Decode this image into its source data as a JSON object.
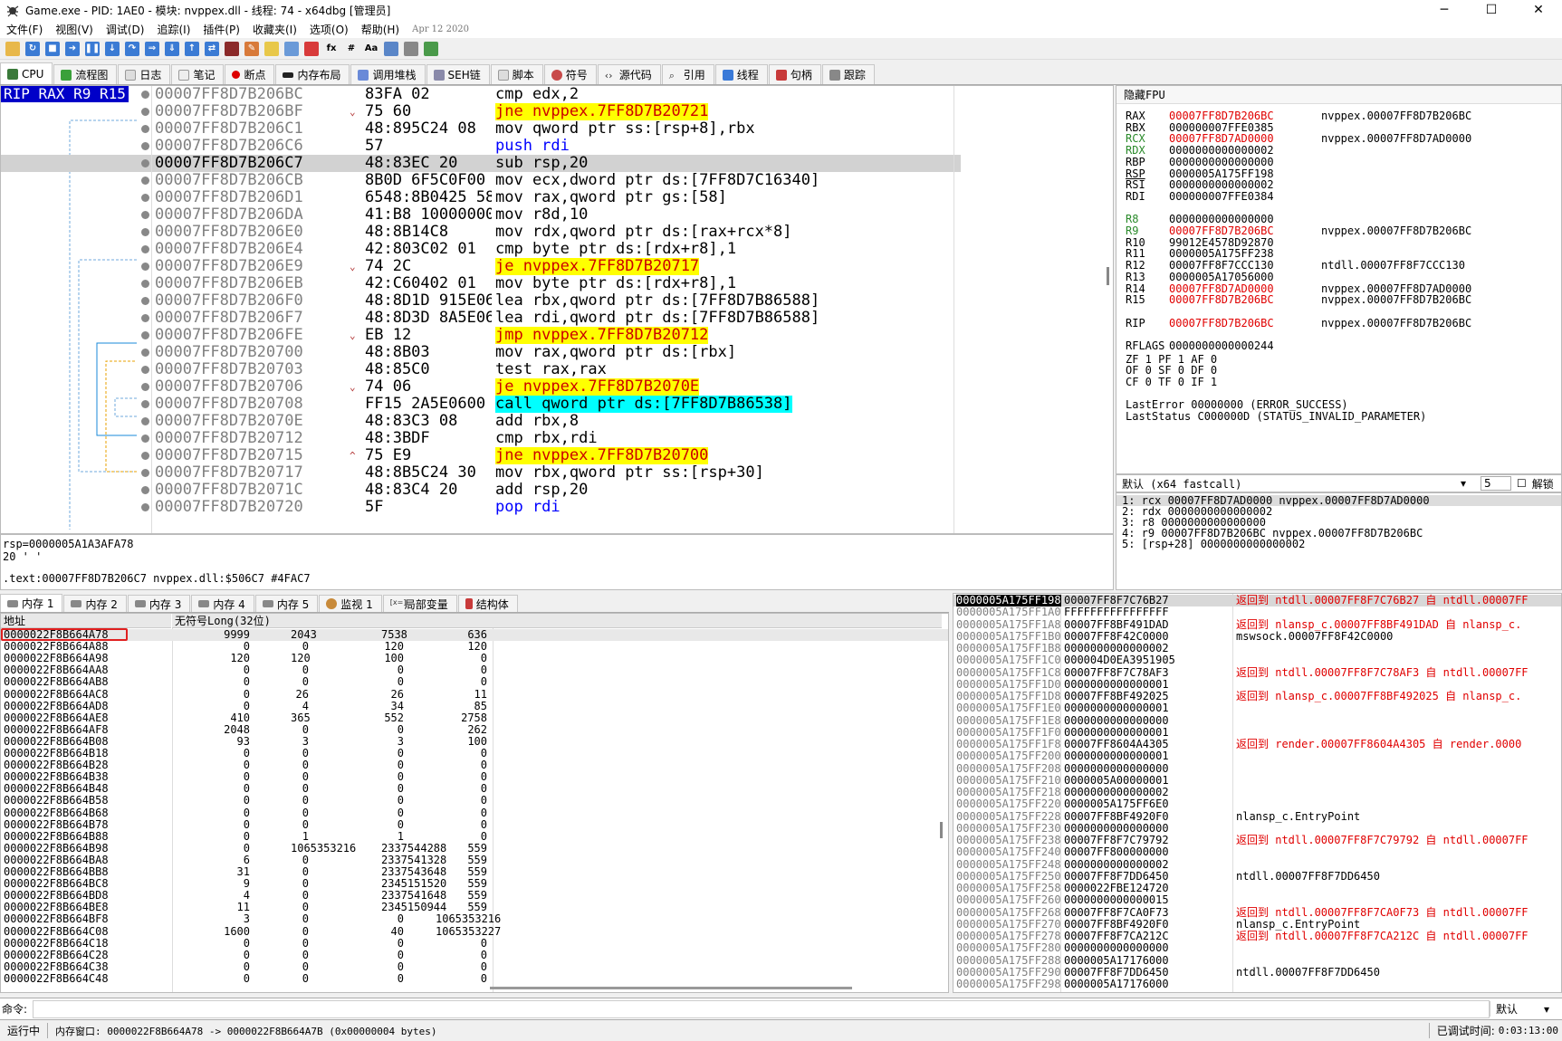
{
  "window": {
    "title": "Game.exe - PID: 1AE0 - 模块: nvppex.dll - 线程: 74 - x64dbg [管理员]"
  },
  "menu": {
    "items": [
      "文件(F)",
      "视图(V)",
      "调试(D)",
      "追踪(I)",
      "插件(P)",
      "收藏夹(I)",
      "选项(O)",
      "帮助(H)"
    ],
    "date": "Apr 12 2020"
  },
  "tabs": [
    "CPU",
    "流程图",
    "日志",
    "笔记",
    "断点",
    "内存布局",
    "调用堆栈",
    "SEH链",
    "脚本",
    "符号",
    "源代码",
    "引用",
    "线程",
    "句柄",
    "跟踪"
  ],
  "disasm": {
    "reg_label": "RIP RAX R9 R15",
    "rows": [
      {
        "addr": "00007FF8D7B206BC",
        "arrow": "",
        "bytes": "83FA 02",
        "inst": "cmp edx,2"
      },
      {
        "addr": "00007FF8D7B206BF",
        "arrow": "⌄",
        "bytes": "75 60",
        "inst": "jne nvppex.7FF8D7B20721"
      },
      {
        "addr": "00007FF8D7B206C1",
        "arrow": "",
        "bytes": "48:895C24 08",
        "inst": "mov qword ptr ss:[rsp+8],rbx"
      },
      {
        "addr": "00007FF8D7B206C6",
        "arrow": "",
        "bytes": "57",
        "inst": "push rdi"
      },
      {
        "addr": "00007FF8D7B206C7",
        "arrow": "",
        "bytes": "48:83EC 20",
        "inst": "sub rsp,20"
      },
      {
        "addr": "00007FF8D7B206CB",
        "arrow": "",
        "bytes": "8B0D 6F5C0F00",
        "inst": "mov ecx,dword ptr ds:[7FF8D7C16340]"
      },
      {
        "addr": "00007FF8D7B206D1",
        "arrow": "",
        "bytes": "6548:8B0425 58",
        "inst": "mov rax,qword ptr gs:[58]"
      },
      {
        "addr": "00007FF8D7B206DA",
        "arrow": "",
        "bytes": "41:B8 10000000",
        "inst": "mov r8d,10"
      },
      {
        "addr": "00007FF8D7B206E0",
        "arrow": "",
        "bytes": "48:8B14C8",
        "inst": "mov rdx,qword ptr ds:[rax+rcx*8]"
      },
      {
        "addr": "00007FF8D7B206E4",
        "arrow": "",
        "bytes": "42:803C02 01",
        "inst": "cmp byte ptr ds:[rdx+r8],1"
      },
      {
        "addr": "00007FF8D7B206E9",
        "arrow": "⌄",
        "bytes": "74 2C",
        "inst": "je nvppex.7FF8D7B20717"
      },
      {
        "addr": "00007FF8D7B206EB",
        "arrow": "",
        "bytes": "42:C60402 01",
        "inst": "mov byte ptr ds:[rdx+r8],1"
      },
      {
        "addr": "00007FF8D7B206F0",
        "arrow": "",
        "bytes": "48:8D1D 915E06",
        "inst": "lea rbx,qword ptr ds:[7FF8D7B86588]"
      },
      {
        "addr": "00007FF8D7B206F7",
        "arrow": "",
        "bytes": "48:8D3D 8A5E06",
        "inst": "lea rdi,qword ptr ds:[7FF8D7B86588]"
      },
      {
        "addr": "00007FF8D7B206FE",
        "arrow": "⌄",
        "bytes": "EB 12",
        "inst": "jmp nvppex.7FF8D7B20712"
      },
      {
        "addr": "00007FF8D7B20700",
        "arrow": "",
        "bytes": "48:8B03",
        "inst": "mov rax,qword ptr ds:[rbx]"
      },
      {
        "addr": "00007FF8D7B20703",
        "arrow": "",
        "bytes": "48:85C0",
        "inst": "test rax,rax"
      },
      {
        "addr": "00007FF8D7B20706",
        "arrow": "⌄",
        "bytes": "74 06",
        "inst": "je nvppex.7FF8D7B2070E"
      },
      {
        "addr": "00007FF8D7B20708",
        "arrow": "",
        "bytes": "FF15 2A5E0600",
        "inst": "call qword ptr ds:[7FF8D7B86538]"
      },
      {
        "addr": "00007FF8D7B2070E",
        "arrow": "",
        "bytes": "48:83C3 08",
        "inst": "add rbx,8"
      },
      {
        "addr": "00007FF8D7B20712",
        "arrow": "",
        "bytes": "48:3BDF",
        "inst": "cmp rbx,rdi"
      },
      {
        "addr": "00007FF8D7B20715",
        "arrow": "^",
        "bytes": "75 E9",
        "inst": "jne nvppex.7FF8D7B20700"
      },
      {
        "addr": "00007FF8D7B20717",
        "arrow": "",
        "bytes": "48:8B5C24 30",
        "inst": "mov rbx,qword ptr ss:[rsp+30]"
      },
      {
        "addr": "00007FF8D7B2071C",
        "arrow": "",
        "bytes": "48:83C4 20",
        "inst": "add rsp,20"
      },
      {
        "addr": "00007FF8D7B20720",
        "arrow": "",
        "bytes": "5F",
        "inst": "pop rdi"
      }
    ]
  },
  "info": {
    "line1": "rsp=0000005A1A3AFA78",
    "line2": "20 ' '",
    "line3": ".text:00007FF8D7B206C7 nvppex.dll:$506C7 #4FAC7"
  },
  "registers": {
    "header": "隐藏FPU",
    "rows": [
      {
        "name": "RAX",
        "value": "00007FF8D7B206BC",
        "comment": "nvppex.00007FF8D7B206BC",
        "red": true
      },
      {
        "name": "RBX",
        "value": "000000007FFE0385",
        "comment": "",
        "red": false
      },
      {
        "name": "RCX",
        "value": "00007FF8D7AD0000",
        "comment": "nvppex.00007FF8D7AD0000",
        "red": true
      },
      {
        "name": "RDX",
        "value": "0000000000000002",
        "comment": "",
        "red": false
      },
      {
        "name": "RBP",
        "value": "0000000000000000",
        "comment": "",
        "red": false
      },
      {
        "name": "RSP",
        "value": "0000005A175FF198",
        "comment": "",
        "red": false
      },
      {
        "name": "RSI",
        "value": "0000000000000002",
        "comment": "",
        "red": false
      },
      {
        "name": "RDI",
        "value": "000000007FFE0384",
        "comment": "",
        "red": false
      },
      {
        "name": "",
        "value": "",
        "comment": "",
        "red": false
      },
      {
        "name": "R8",
        "value": "0000000000000000",
        "comment": "",
        "red": false
      },
      {
        "name": "R9",
        "value": "00007FF8D7B206BC",
        "comment": "nvppex.00007FF8D7B206BC",
        "red": true
      },
      {
        "name": "R10",
        "value": "99012E4578D92870",
        "comment": "",
        "red": false
      },
      {
        "name": "R11",
        "value": "0000005A175FF238",
        "comment": "",
        "red": false
      },
      {
        "name": "R12",
        "value": "00007FF8F7CCC130",
        "comment": "ntdll.00007FF8F7CCC130",
        "red": false
      },
      {
        "name": "R13",
        "value": "0000005A17056000",
        "comment": "",
        "red": false
      },
      {
        "name": "R14",
        "value": "00007FF8D7AD0000",
        "comment": "nvppex.00007FF8D7AD0000",
        "red": true
      },
      {
        "name": "R15",
        "value": "00007FF8D7B206BC",
        "comment": "nvppex.00007FF8D7B206BC",
        "red": true
      },
      {
        "name": "",
        "value": "",
        "comment": "",
        "red": false
      },
      {
        "name": "RIP",
        "value": "00007FF8D7B206BC",
        "comment": "nvppex.00007FF8D7B206BC",
        "red": true
      },
      {
        "name": "",
        "value": "",
        "comment": "",
        "red": false
      },
      {
        "name": "RFLAGS",
        "value": "0000000000000244",
        "comment": "",
        "red": false
      }
    ],
    "flags": [
      "ZF 1   PF 1   AF 0",
      "OF 0   SF 0   DF 0",
      "CF 0   TF 0   IF 1"
    ],
    "lasterror": "LastError  00000000 (ERROR_SUCCESS)",
    "laststatus": "LastStatus C000000D (STATUS_INVALID_PARAMETER)"
  },
  "callconv": {
    "label": "默认 (x64 fastcall)",
    "count": "5",
    "unlock": "解锁"
  },
  "args": [
    "1: rcx 00007FF8D7AD0000 nvppex.00007FF8D7AD0000",
    "2: rdx 0000000000000002",
    "3: r8 0000000000000000",
    "4: r9 00007FF8D7B206BC nvppex.00007FF8D7B206BC",
    "5: [rsp+28] 0000000000000002"
  ],
  "memtabs": [
    "内存 1",
    "内存 2",
    "内存 3",
    "内存 4",
    "内存 5",
    "监视 1",
    "局部变量",
    "结构体"
  ],
  "dump": {
    "col_addr": "地址",
    "col_type": "无符号Long(32位)",
    "rows": [
      [
        "0000022F8B664A78",
        "9999",
        "2043",
        "7538",
        "636"
      ],
      [
        "0000022F8B664A88",
        "0",
        "0",
        "120",
        "120"
      ],
      [
        "0000022F8B664A98",
        "120",
        "120",
        "100",
        "0"
      ],
      [
        "0000022F8B664AA8",
        "0",
        "0",
        "0",
        "0"
      ],
      [
        "0000022F8B664AB8",
        "0",
        "0",
        "0",
        "0"
      ],
      [
        "0000022F8B664AC8",
        "0",
        "26",
        "26",
        "11"
      ],
      [
        "0000022F8B664AD8",
        "0",
        "4",
        "34",
        "85"
      ],
      [
        "0000022F8B664AE8",
        "410",
        "365",
        "552",
        "2758"
      ],
      [
        "0000022F8B664AF8",
        "2048",
        "0",
        "0",
        "262"
      ],
      [
        "0000022F8B664B08",
        "93",
        "3",
        "3",
        "100"
      ],
      [
        "0000022F8B664B18",
        "0",
        "0",
        "0",
        "0"
      ],
      [
        "0000022F8B664B28",
        "0",
        "0",
        "0",
        "0"
      ],
      [
        "0000022F8B664B38",
        "0",
        "0",
        "0",
        "0"
      ],
      [
        "0000022F8B664B48",
        "0",
        "0",
        "0",
        "0"
      ],
      [
        "0000022F8B664B58",
        "0",
        "0",
        "0",
        "0"
      ],
      [
        "0000022F8B664B68",
        "0",
        "0",
        "0",
        "0"
      ],
      [
        "0000022F8B664B78",
        "0",
        "0",
        "0",
        "0"
      ],
      [
        "0000022F8B664B88",
        "0",
        "1",
        "1",
        "0"
      ],
      [
        "0000022F8B664B98",
        "0",
        "1065353216",
        "2337544288",
        "559"
      ],
      [
        "0000022F8B664BA8",
        "6",
        "0",
        "2337541328",
        "559"
      ],
      [
        "0000022F8B664BB8",
        "31",
        "0",
        "2337543648",
        "559"
      ],
      [
        "0000022F8B664BC8",
        "9",
        "0",
        "2345151520",
        "559"
      ],
      [
        "0000022F8B664BD8",
        "4",
        "0",
        "2337541648",
        "559"
      ],
      [
        "0000022F8B664BE8",
        "11",
        "0",
        "2345150944",
        "559"
      ],
      [
        "0000022F8B664BF8",
        "3",
        "0",
        "0",
        "1065353216"
      ],
      [
        "0000022F8B664C08",
        "1600",
        "0",
        "40",
        "1065353227"
      ],
      [
        "0000022F8B664C18",
        "0",
        "0",
        "0",
        "0"
      ],
      [
        "0000022F8B664C28",
        "0",
        "0",
        "0",
        "0"
      ],
      [
        "0000022F8B664C38",
        "0",
        "0",
        "0",
        "0"
      ],
      [
        "0000022F8B664C48",
        "0",
        "0",
        "0",
        "0"
      ]
    ]
  },
  "stack": {
    "rows": [
      {
        "addr": "0000005A175FF198",
        "val": "00007FF8F7C76B27",
        "comment": "返回到 ntdll.00007FF8F7C76B27 自 ntdll.00007FF",
        "red": true
      },
      {
        "addr": "0000005A175FF1A0",
        "val": "FFFFFFFFFFFFFFFF",
        "comment": "",
        "red": false
      },
      {
        "addr": "0000005A175FF1A8",
        "val": "00007FF8BF491DAD",
        "comment": "返回到 nlansp_c.00007FF8BF491DAD 自 nlansp_c.",
        "red": true
      },
      {
        "addr": "0000005A175FF1B0",
        "val": "00007FF8F42C0000",
        "comment": "mswsock.00007FF8F42C0000",
        "red": false
      },
      {
        "addr": "0000005A175FF1B8",
        "val": "0000000000000002",
        "comment": "",
        "red": false
      },
      {
        "addr": "0000005A175FF1C0",
        "val": "000004D0EA3951905",
        "comment": "",
        "red": false
      },
      {
        "addr": "0000005A175FF1C8",
        "val": "00007FF8F7C78AF3",
        "comment": "返回到 ntdll.00007FF8F7C78AF3 自 ntdll.00007FF",
        "red": true
      },
      {
        "addr": "0000005A175FF1D0",
        "val": "0000000000000001",
        "comment": "",
        "red": false
      },
      {
        "addr": "0000005A175FF1D8",
        "val": "00007FF8BF492025",
        "comment": "返回到 nlansp_c.00007FF8BF492025 自 nlansp_c.",
        "red": true
      },
      {
        "addr": "0000005A175FF1E0",
        "val": "0000000000000001",
        "comment": "",
        "red": false
      },
      {
        "addr": "0000005A175FF1E8",
        "val": "0000000000000000",
        "comment": "",
        "red": false
      },
      {
        "addr": "0000005A175FF1F0",
        "val": "0000000000000001",
        "comment": "",
        "red": false
      },
      {
        "addr": "0000005A175FF1F8",
        "val": "00007FF8604A4305",
        "comment": "返回到 render.00007FF8604A4305 自 render.0000",
        "red": true
      },
      {
        "addr": "0000005A175FF200",
        "val": "0000000000000001",
        "comment": "",
        "red": false
      },
      {
        "addr": "0000005A175FF208",
        "val": "0000000000000000",
        "comment": "",
        "red": false
      },
      {
        "addr": "0000005A175FF210",
        "val": "0000005A00000001",
        "comment": "",
        "red": false
      },
      {
        "addr": "0000005A175FF218",
        "val": "0000000000000002",
        "comment": "",
        "red": false
      },
      {
        "addr": "0000005A175FF220",
        "val": "0000005A175FF6E0",
        "comment": "",
        "red": false
      },
      {
        "addr": "0000005A175FF228",
        "val": "00007FF8BF4920F0",
        "comment": "nlansp_c.EntryPoint",
        "red": false
      },
      {
        "addr": "0000005A175FF230",
        "val": "0000000000000000",
        "comment": "",
        "red": false
      },
      {
        "addr": "0000005A175FF238",
        "val": "00007FF8F7C79792",
        "comment": "返回到 ntdll.00007FF8F7C79792 自 ntdll.00007FF",
        "red": true
      },
      {
        "addr": "0000005A175FF240",
        "val": "00007FF800000000",
        "comment": "",
        "red": false
      },
      {
        "addr": "0000005A175FF248",
        "val": "0000000000000002",
        "comment": "",
        "red": false
      },
      {
        "addr": "0000005A175FF250",
        "val": "00007FF8F7DD6450",
        "comment": "ntdll.00007FF8F7DD6450",
        "red": false
      },
      {
        "addr": "0000005A175FF258",
        "val": "0000022FBE124720",
        "comment": "",
        "red": false
      },
      {
        "addr": "0000005A175FF260",
        "val": "0000000000000015",
        "comment": "",
        "red": false
      },
      {
        "addr": "0000005A175FF268",
        "val": "00007FF8F7CA0F73",
        "comment": "返回到 ntdll.00007FF8F7CA0F73 自 ntdll.00007FF",
        "red": true
      },
      {
        "addr": "0000005A175FF270",
        "val": "00007FF8BF4920F0",
        "comment": "nlansp_c.EntryPoint",
        "red": false
      },
      {
        "addr": "0000005A175FF278",
        "val": "00007FF8F7CA212C",
        "comment": "返回到 ntdll.00007FF8F7CA212C 自 ntdll.00007FF",
        "red": true
      },
      {
        "addr": "0000005A175FF280",
        "val": "0000000000000000",
        "comment": "",
        "red": false
      },
      {
        "addr": "0000005A175FF288",
        "val": "0000005A17176000",
        "comment": "",
        "red": false
      },
      {
        "addr": "0000005A175FF290",
        "val": "00007FF8F7DD6450",
        "comment": "ntdll.00007FF8F7DD6450",
        "red": false
      },
      {
        "addr": "0000005A175FF298",
        "val": "0000005A17176000",
        "comment": "",
        "red": false
      }
    ]
  },
  "cmd": {
    "label": "命令:",
    "mode": "默认"
  },
  "status": {
    "state": "运行中",
    "text": "内存窗口: 0000022F8B664A78 -> 0000022F8B664A7B (0x00000004 bytes)",
    "timer_label": "已调试时间:",
    "timer": "0:03:13:00"
  }
}
